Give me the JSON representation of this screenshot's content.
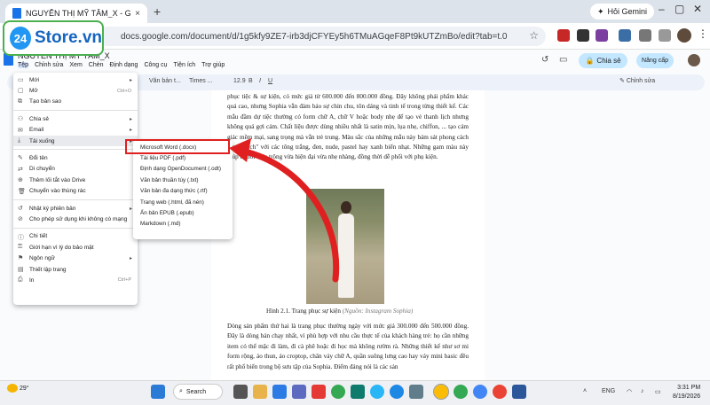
{
  "browser": {
    "tab_title": "NGUYỄN THỊ MỸ TÂM_X - Goo",
    "tab_close": "×",
    "new_tab": "+",
    "address": "docs.google.com/document/d/1g5kfy9ZE7-irb3djCFYEy5h6TMuAGqeF8Pt9kUTZmBo/edit?tab=t.0",
    "gemini_label": "Hỏi Gemini",
    "window_controls": [
      "–",
      "▢",
      "✕"
    ]
  },
  "logo": {
    "number": "24",
    "text": "Store.vn"
  },
  "doc": {
    "title": "NGUYỄN THỊ MỸ TÂM_X",
    "menu": [
      "Tệp",
      "Chỉnh sửa",
      "Xem",
      "Chèn",
      "Định dạng",
      "Công cụ",
      "Tiện ích",
      "Trợ giúp"
    ],
    "share_label": "Chia sẻ",
    "upgrade_label": "Nâng cấp",
    "toolbar": {
      "style": "Văn bản t...",
      "font": "Times ...",
      "size": "12.9",
      "mode": "Chỉnh sửa"
    }
  },
  "file_menu": [
    {
      "icon": "▭",
      "label": "Mới",
      "shortcut": "",
      "arrow": "▸"
    },
    {
      "icon": "▢",
      "label": "Mở",
      "shortcut": "Ctrl+O",
      "arrow": ""
    },
    {
      "icon": "⧉",
      "label": "Tạo bản sao",
      "shortcut": "",
      "arrow": ""
    },
    {
      "icon": "⚇",
      "label": "Chia sẻ",
      "shortcut": "",
      "arrow": "▸"
    },
    {
      "icon": "✉",
      "label": "Email",
      "shortcut": "",
      "arrow": "▸"
    },
    {
      "icon": "⤓",
      "label": "Tải xuống",
      "shortcut": "",
      "arrow": "▸"
    },
    {
      "icon": "✎",
      "label": "Đổi tên",
      "shortcut": "",
      "arrow": ""
    },
    {
      "icon": "⇄",
      "label": "Di chuyển",
      "shortcut": "",
      "arrow": ""
    },
    {
      "icon": "⊕",
      "label": "Thêm lối tắt vào Drive",
      "shortcut": "",
      "arrow": ""
    },
    {
      "icon": "🗑",
      "label": "Chuyển vào thùng rác",
      "shortcut": "",
      "arrow": ""
    },
    {
      "icon": "↺",
      "label": "Nhật ký phiên bản",
      "shortcut": "",
      "arrow": "▸"
    },
    {
      "icon": "⊘",
      "label": "Cho phép sử dụng khi không có mạng",
      "shortcut": "",
      "arrow": ""
    },
    {
      "icon": "ⓘ",
      "label": "Chi tiết",
      "shortcut": "",
      "arrow": ""
    },
    {
      "icon": "⚿",
      "label": "Giới hạn vì lý do bảo mật",
      "shortcut": "",
      "arrow": ""
    },
    {
      "icon": "⚑",
      "label": "Ngôn ngữ",
      "shortcut": "",
      "arrow": "▸"
    },
    {
      "icon": "▤",
      "label": "Thiết lập trang",
      "shortcut": "",
      "arrow": ""
    },
    {
      "icon": "⎙",
      "label": "In",
      "shortcut": "Ctrl+P",
      "arrow": ""
    }
  ],
  "download_submenu": [
    "Microsoft Word (.docx)",
    "Tài liệu PDF (.pdf)",
    "Định dạng OpenDocument (.odt)",
    "Văn bản thuần túy (.txt)",
    "Văn bản đa dạng thức (.rtf)",
    "Trang web (.html, đã nén)",
    "Ấn bản EPUB (.epub)",
    "Markdown (.md)"
  ],
  "content": {
    "para1": "phục tiệc & sự kiện, có mức giá từ 600.000 đến 800.000 đồng. Đây không phải phẩm khác quá cao, nhưng Sophia vẫn đảm bảo sự chỉn chu, tôn dáng và tinh tế trong từng thiết kế. Các mẫu đầm dự tiệc thường có form chữ A, chữ V hoặc body nhẹ để tạo vẻ thanh lịch nhưng không quá gợi cảm. Chất liệu được dùng nhiều nhất là satin mịn, lụa nhẹ, chiffon, ... tạo cảm giác mềm mại, sang trọng mà vẫn trẻ trung. Màu sắc của những mẫu này bám sát phong cách \"thanh lịch\" với các tông trắng, đen, nude, pastel hay xanh biển nhạt. Những gam màu này giúp người mặc trông vừa hiện đại vừa nhẹ nhàng, đồng thời dễ phối với phụ kiện.",
    "caption_main": "Hình 2.1. Trang phục sự kiện ",
    "caption_src": "(Nguồn: Instagram Sophia)",
    "para2": "Dòng sản phẩm thứ hai là trang phục thường ngày với mức giá 300.000 đến 500.000 đồng. Đây là dòng bán chạy nhất, vì phù hợp với nhu cầu thực tế của khách hàng trẻ: họ cần những item có thể mặc đi làm, đi cà phê hoặc đi học mà không rườm rà. Những thiết kế như sơ mi form rộng, áo thun, áo croptop, chân váy chữ A, quần suông lưng cao hay váy mini basic đều rất phổ biến trong bộ sưu tập của Sophia. Điểm đáng nói là các sản"
  },
  "taskbar": {
    "temp": "29°",
    "search_label": "Search",
    "lang": "ENG",
    "time": "3:31 PM",
    "date": "8/19/2026"
  }
}
